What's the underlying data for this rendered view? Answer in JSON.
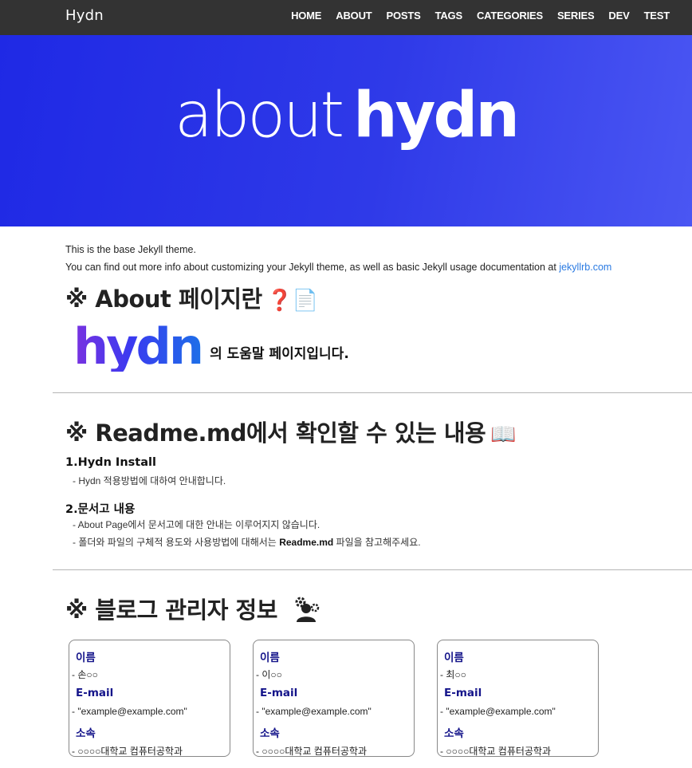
{
  "header": {
    "brand": "Hydn",
    "nav": [
      "HOME",
      "ABOUT",
      "POSTS",
      "TAGS",
      "CATEGORIES",
      "SERIES",
      "DEV",
      "TEST"
    ]
  },
  "hero": {
    "light": "about",
    "bold": "hydn",
    "colors": {
      "start": "#1f29e5",
      "end": "#4a56f3"
    }
  },
  "intro": {
    "line1": "This is the base Jekyll theme.",
    "line2_prefix": "You can find out more info about customizing your Jekyll theme, as well as basic Jekyll usage documentation at ",
    "link": "jekyllrb.com"
  },
  "section1": {
    "title": "※ About 페이지란",
    "icon": "question-memo-icon",
    "logo_text": "hydn",
    "logo_suffix": "의 도움말 페이지입니다."
  },
  "section2": {
    "title": "※ Readme.md에서 확인할 수 있는 내용",
    "icon": "open-book-icon",
    "items": [
      {
        "title": "1.Hydn Install",
        "lines": [
          "- Hydn 적용방법에 대하여 안내합니다."
        ]
      },
      {
        "title": "2.문서고 내용",
        "lines": [
          "- About Page에서 문서고에 대한 안내는 이루어지지 않습니다."
        ],
        "line2_prefix": "- 폴더와 파일의 구체적 용도와 사용방법에 대해서는 ",
        "line2_bold": "Readme.md",
        "line2_suffix": " 파일을 참고해주세요."
      }
    ]
  },
  "section3": {
    "title": "※ 블로그 관리자 정보",
    "icon": "admin-gears-icon",
    "labels": {
      "name": "이름",
      "email": "E-mail",
      "affiliation": "소속"
    },
    "cards": [
      {
        "name": "- 손○○",
        "email": "- \"example@example.com\"",
        "affiliation": "- ○○○○대학교 컴퓨터공학과"
      },
      {
        "name": "- 이○○",
        "email": "- \"example@example.com\"",
        "affiliation": "- ○○○○대학교 컴퓨터공학과"
      },
      {
        "name": "- 최○○",
        "email": "- \"example@example.com\"",
        "affiliation": "- ○○○○대학교 컴퓨터공학과"
      }
    ]
  }
}
